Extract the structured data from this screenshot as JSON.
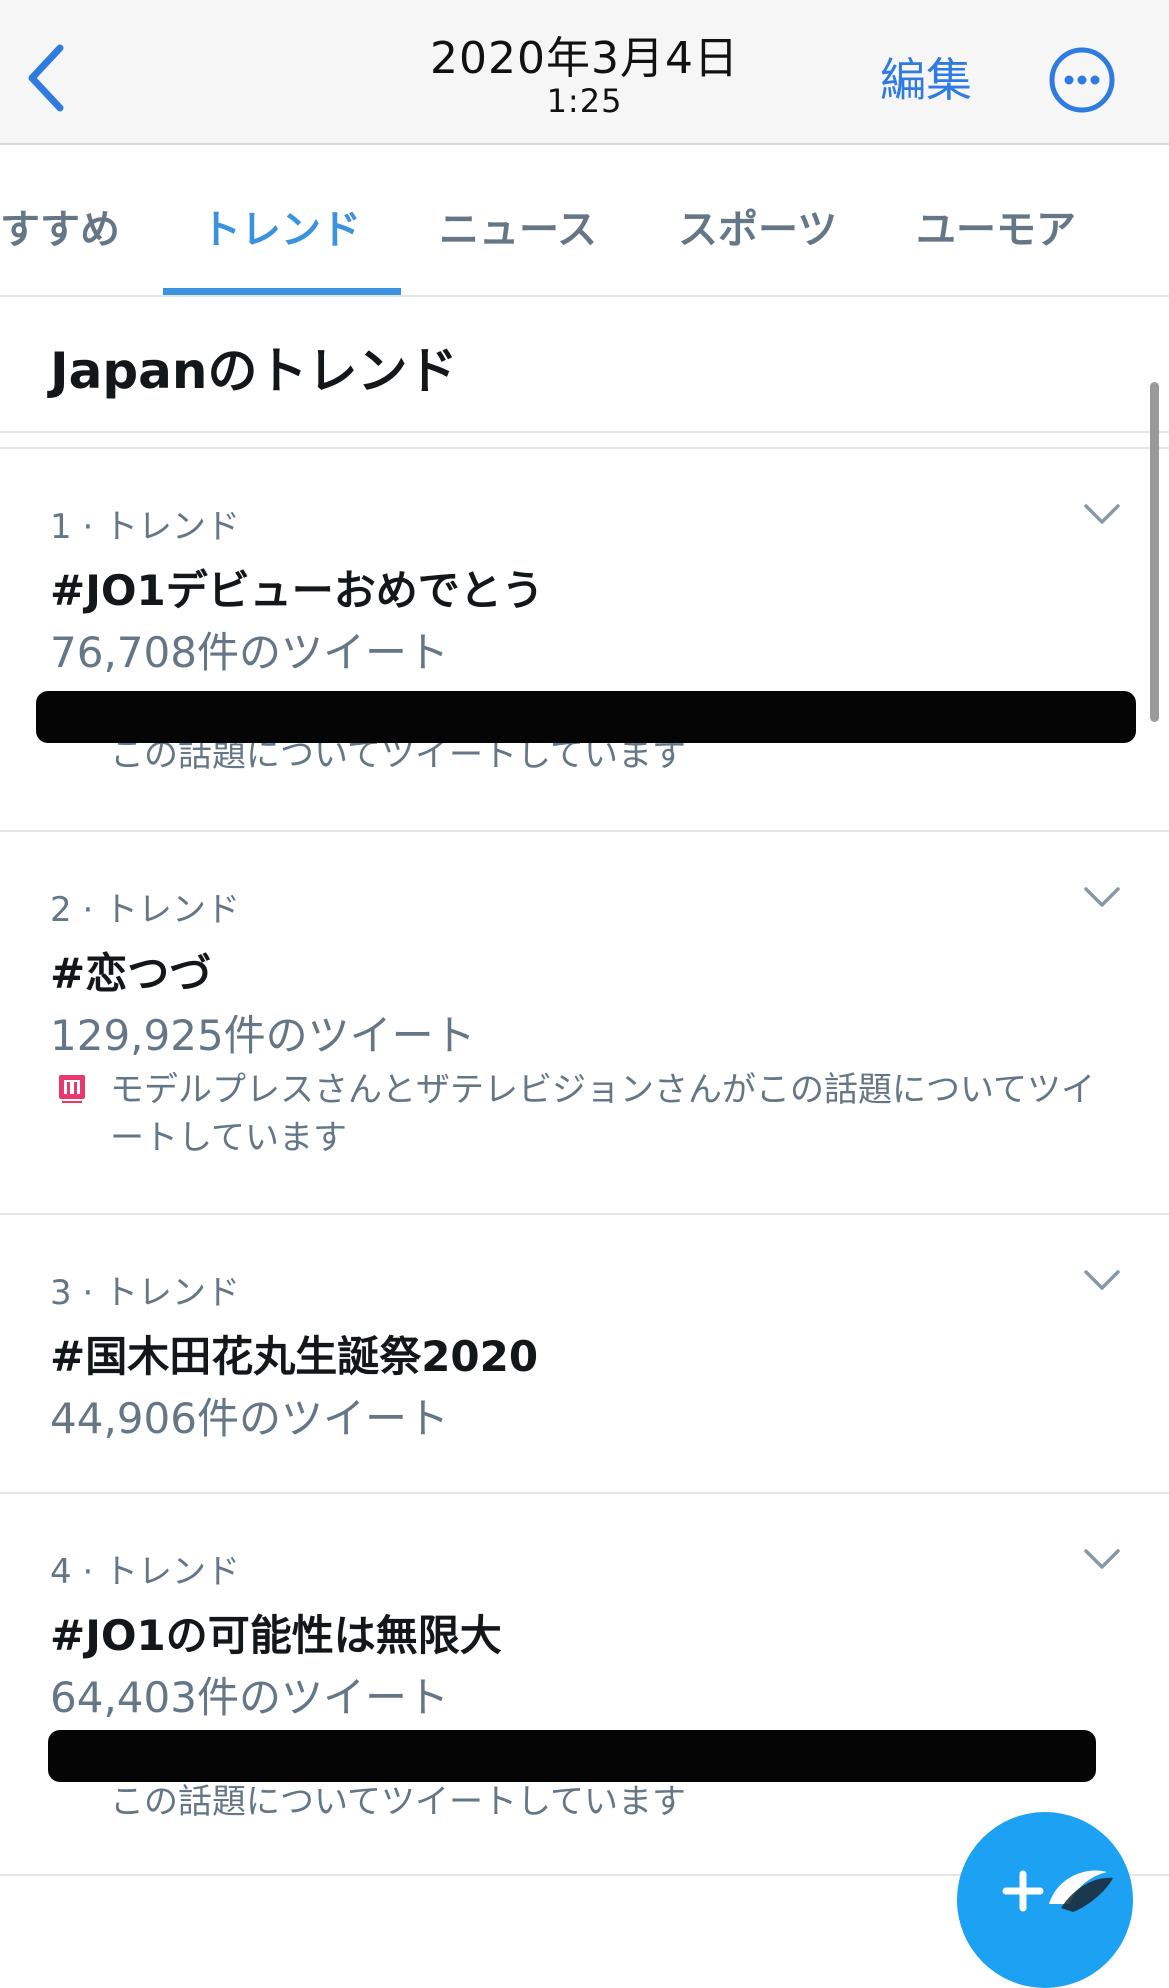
{
  "header": {
    "date": "2020年3月4日",
    "time": "1:25",
    "edit_label": "編集",
    "back_icon": "chevron-left-icon",
    "more_icon": "ellipsis-circle-icon",
    "accent_color": "#2f7be0"
  },
  "tabs": {
    "items": [
      {
        "label": "おすすめ",
        "active": false
      },
      {
        "label": "トレンド",
        "active": true
      },
      {
        "label": "ニュース",
        "active": false
      },
      {
        "label": "スポーツ",
        "active": false
      },
      {
        "label": "ユーモア",
        "active": false
      }
    ],
    "active_color": "#3b93e0"
  },
  "section": {
    "title": "Japanのトレンド"
  },
  "trends": [
    {
      "meta": "1 · トレンド",
      "name": "#JO1デビューおめでとう",
      "count": "76,708件のツイート",
      "context": "この話題についてツイートしています",
      "context_redacted": true
    },
    {
      "meta": "2 · トレンド",
      "name": "#恋つづ",
      "count": "129,925件のツイート",
      "context": "モデルプレスさんとザテレビジョンさんがこの話題についてツイートしています",
      "context_icon": "modelpress-logo-icon"
    },
    {
      "meta": "3 · トレンド",
      "name": "#国木田花丸生誕祭2020",
      "count": "44,906件のツイート"
    },
    {
      "meta": "4 · トレンド",
      "name": "#JO1の可能性は無限大",
      "count": "64,403件のツイート",
      "context": "この話題についてツイートしています",
      "context_redacted": true
    }
  ],
  "fab": {
    "icon": "compose-tweet-icon",
    "color": "#1da1f2"
  }
}
